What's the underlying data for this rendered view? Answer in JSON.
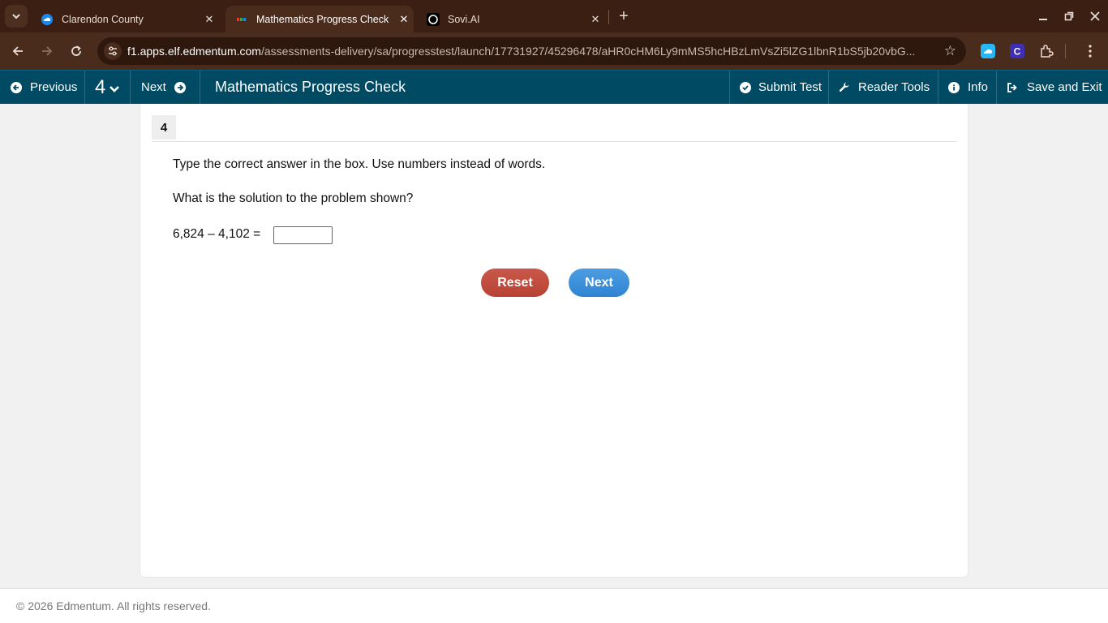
{
  "browser": {
    "tabs": [
      {
        "title": "Clarendon County",
        "active": false,
        "favicon": "cloud-icon"
      },
      {
        "title": "Mathematics Progress Check",
        "active": true,
        "favicon": "edmentum-icon"
      },
      {
        "title": "Sovi.AI",
        "active": false,
        "favicon": "sovi-icon"
      }
    ],
    "url_host": "f1.apps.elf.edmentum.com",
    "url_path": "/assessments-delivery/sa/progresstest/launch/17731927/45296478/aHR0cHM6Ly9mMS5hcHBzLmVsZi5lZG1lbnR1bS5jb20vbG..."
  },
  "appbar": {
    "previous_label": "Previous",
    "question_number": "4",
    "next_label": "Next",
    "title": "Mathematics Progress Check",
    "submit_label": "Submit Test",
    "reader_tools_label": "Reader Tools",
    "info_label": "Info",
    "save_exit_label": "Save and Exit"
  },
  "question": {
    "number": "4",
    "instruction": "Type the correct answer in the box. Use numbers instead of words.",
    "prompt": "What is the solution to the problem shown?",
    "equation": "6,824 – 4,102 =",
    "answer_value": ""
  },
  "buttons": {
    "reset_label": "Reset",
    "next_label": "Next"
  },
  "footer": {
    "copyright": "© 2026 Edmentum. All rights reserved."
  },
  "colors": {
    "appbar": "#004a63",
    "reset": "#b84233",
    "next": "#2f84d2",
    "browser_frame": "#3a1f12"
  }
}
